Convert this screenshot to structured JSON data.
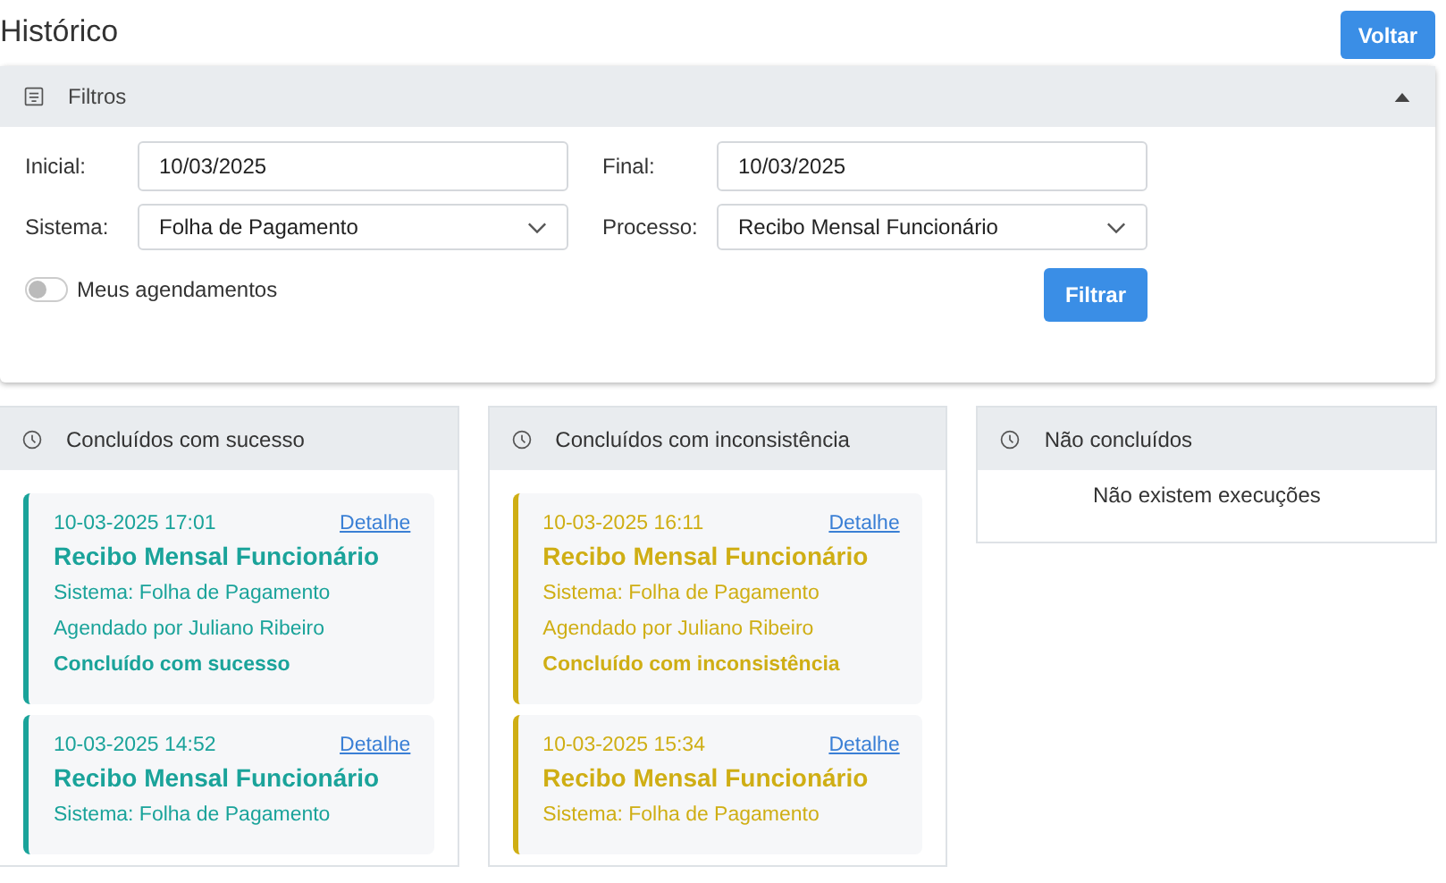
{
  "page": {
    "title": "Histórico",
    "back_button": "Voltar"
  },
  "filters": {
    "title": "Filtros",
    "expanded": true,
    "initial_label": "Inicial:",
    "initial_value": "10/03/2025",
    "final_label": "Final:",
    "final_value": "10/03/2025",
    "system_label": "Sistema:",
    "system_value": "Folha de Pagamento",
    "process_label": "Processo:",
    "process_value": "Recibo Mensal Funcionário",
    "toggle": {
      "label": "Meus agendamentos",
      "on": false
    },
    "submit_button": "Filtrar"
  },
  "columns": [
    {
      "title": "Concluídos com sucesso",
      "kind": "success",
      "cards": [
        {
          "datetime": "10-03-2025 17:01",
          "link": "Detalhe",
          "title": "Recibo Mensal Funcionário",
          "lines": [
            "Sistema: Folha de Pagamento",
            "Agendado por Juliano Ribeiro"
          ],
          "status": "Concluído com sucesso"
        },
        {
          "datetime": "10-03-2025 14:52",
          "link": "Detalhe",
          "title": "Recibo Mensal Funcionário",
          "lines": [
            "Sistema: Folha de Pagamento"
          ]
        }
      ]
    },
    {
      "title": "Concluídos com inconsistência",
      "kind": "warning",
      "cards": [
        {
          "datetime": "10-03-2025 16:11",
          "link": "Detalhe",
          "title": "Recibo Mensal Funcionário",
          "lines": [
            "Sistema: Folha de Pagamento",
            "Agendado por Juliano Ribeiro"
          ],
          "status": "Concluído com inconsistência"
        },
        {
          "datetime": "10-03-2025 15:34",
          "link": "Detalhe",
          "title": "Recibo Mensal Funcionário",
          "lines": [
            "Sistema: Folha de Pagamento"
          ]
        }
      ]
    },
    {
      "title": "Não concluídos",
      "kind": "failed",
      "empty_text": "Não existem execuções"
    }
  ]
}
